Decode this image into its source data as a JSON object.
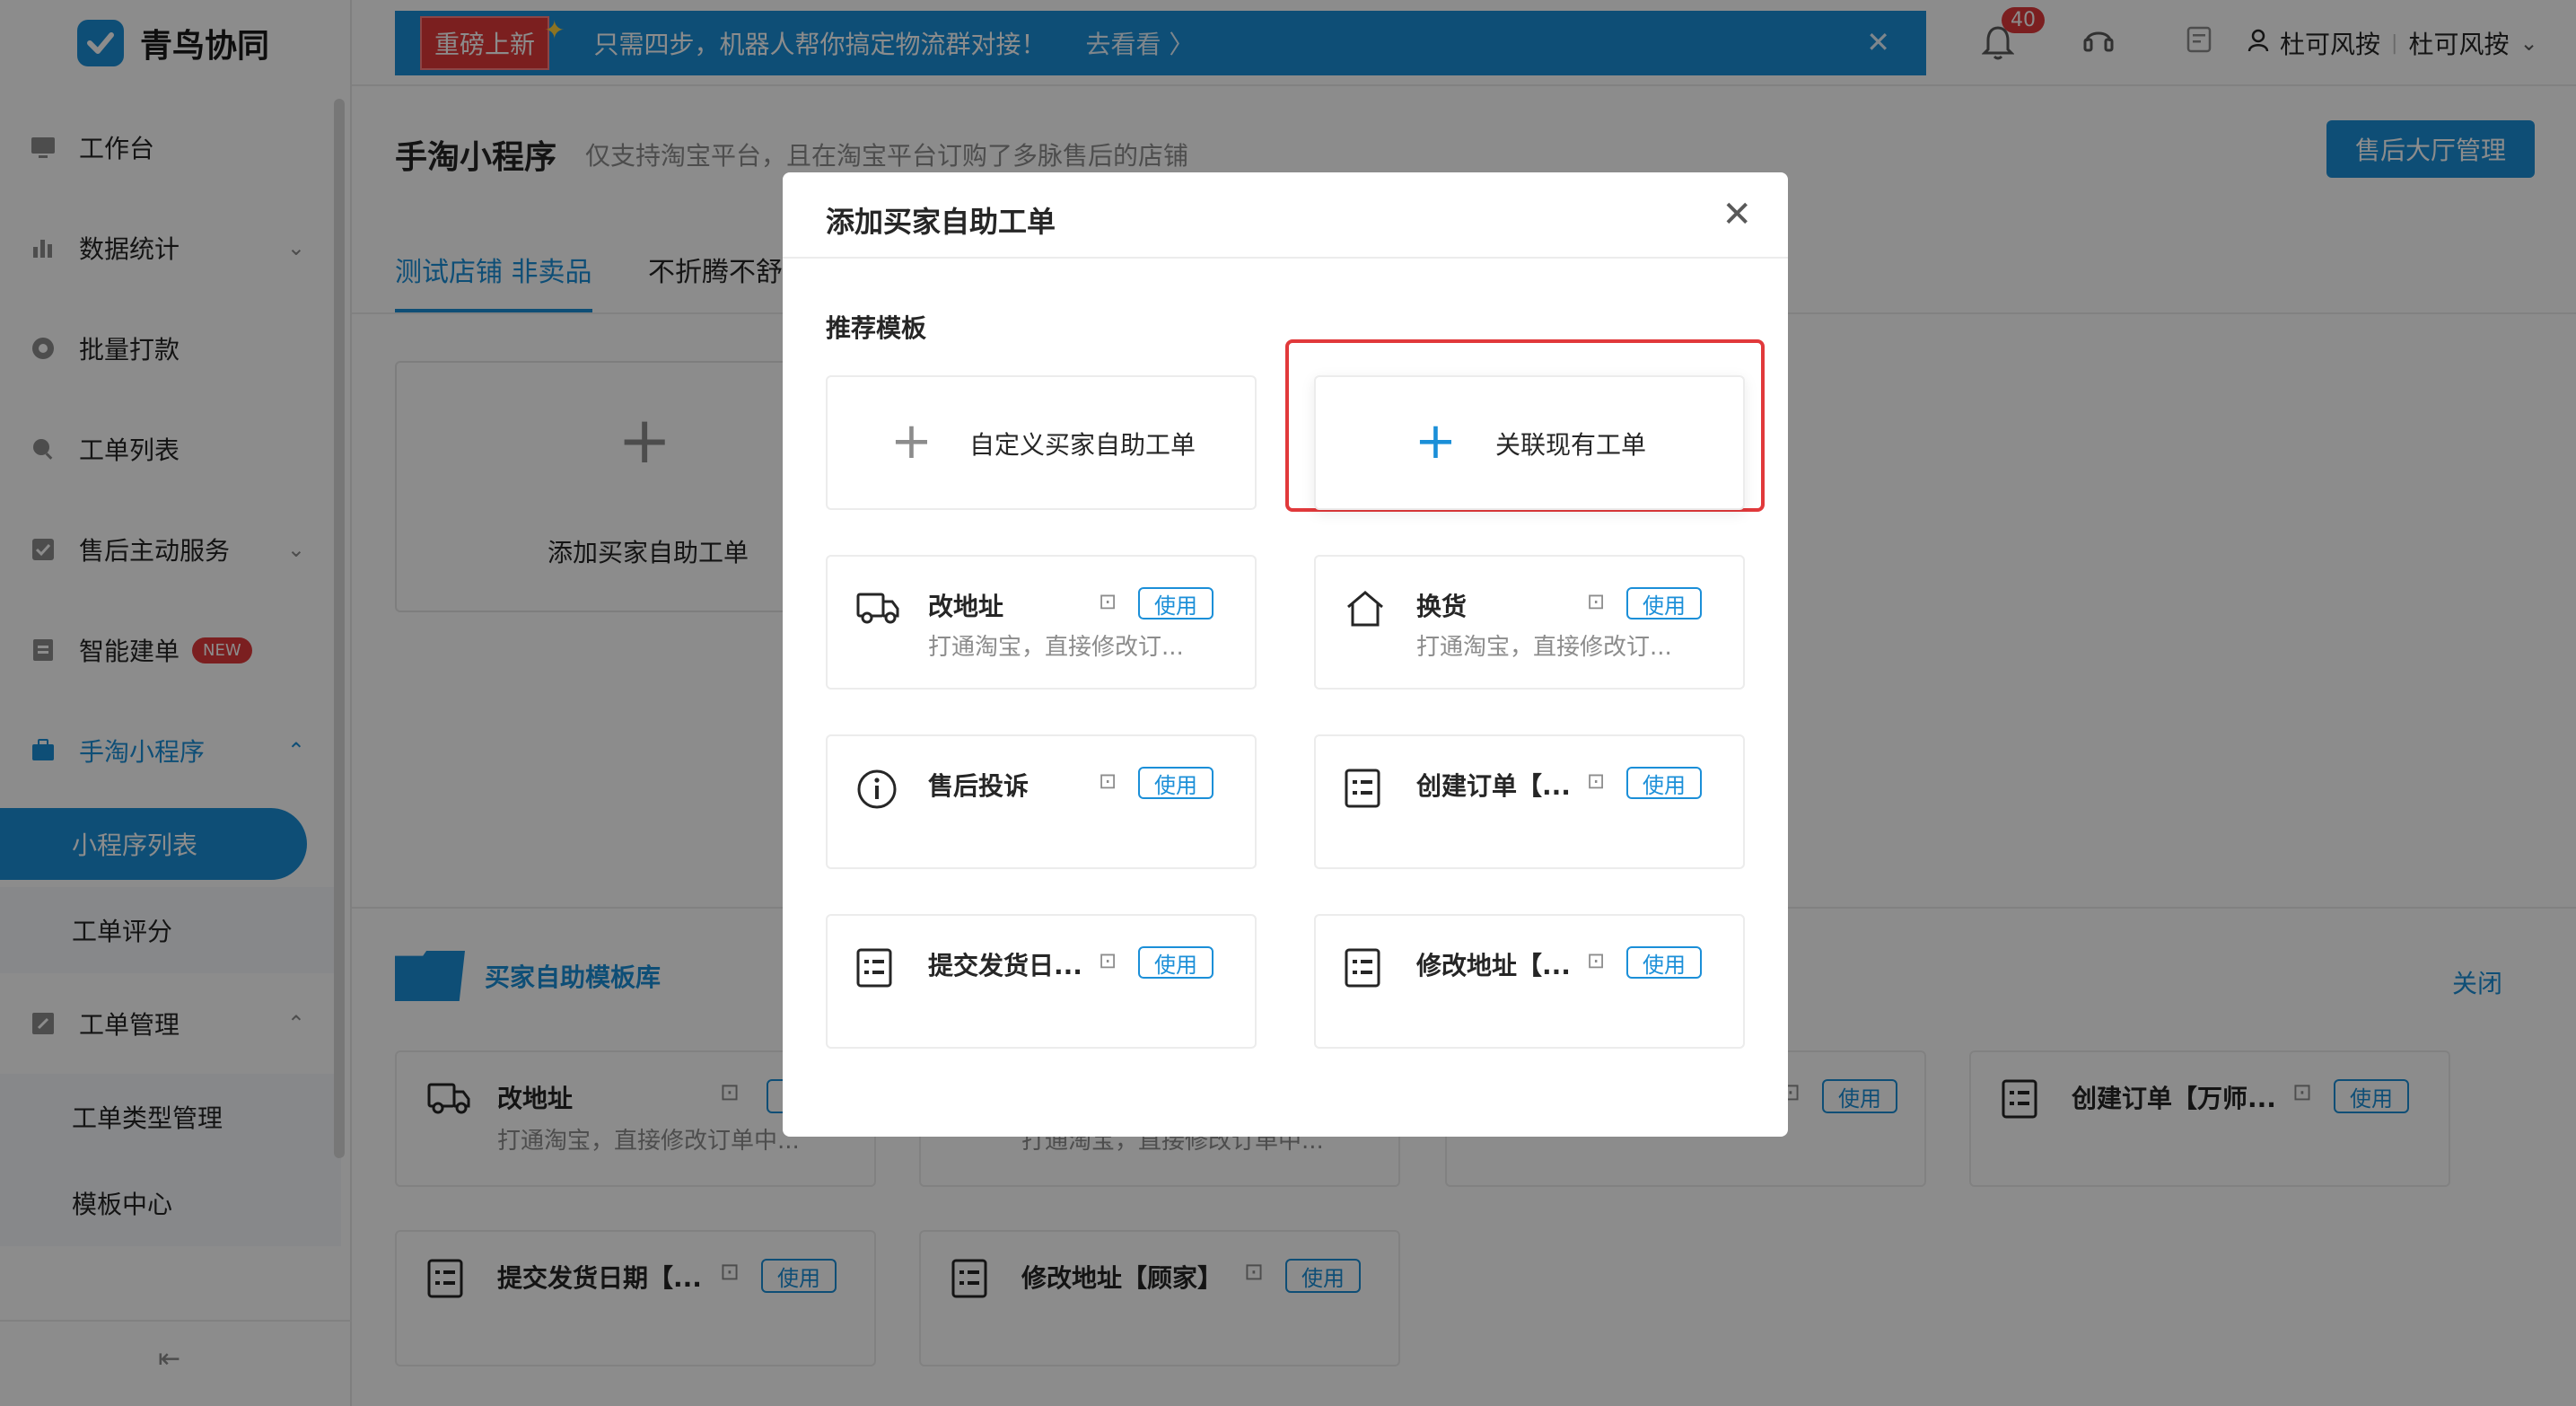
{
  "brand": {
    "name": "青鸟协同",
    "accent": "#1b8fd8"
  },
  "sidebar": {
    "items": [
      {
        "label": "工作台",
        "icon": "monitor-icon"
      },
      {
        "label": "数据统计",
        "icon": "bar-chart-icon"
      },
      {
        "label": "批量打款",
        "icon": "coin-icon"
      },
      {
        "label": "工单列表",
        "icon": "search-icon"
      },
      {
        "label": "售后主动服务",
        "icon": "check-square-icon"
      },
      {
        "label": "智能建单",
        "icon": "document-icon",
        "badge": "NEW"
      },
      {
        "label": "手淘小程序",
        "icon": "briefcase-icon"
      },
      {
        "label": "小程序列表"
      },
      {
        "label": "工单评分"
      },
      {
        "label": "工单管理",
        "icon": "edit-icon"
      },
      {
        "label": "工单类型管理"
      },
      {
        "label": "模板中心"
      }
    ]
  },
  "header": {
    "banner_tag": "重磅上新",
    "banner_msg": "只需四步，机器人帮你搞定物流群对接！",
    "banner_more": "去看看 〉",
    "notif_count": "40",
    "user_name": "杜可风按",
    "shop_name": "杜可风按"
  },
  "page": {
    "title": "手淘小程序",
    "desc": "仅支持淘宝平台，且在淘宝平台订购了多脉售后的店铺",
    "primary_button": "售后大厅管理",
    "tabs": [
      "测试店铺 非卖品",
      "不折腾不舒"
    ],
    "add_card_label": "添加买家自助工单"
  },
  "library": {
    "title": "买家自助模板库",
    "close_label": "关闭",
    "use_label": "使用",
    "templates": [
      {
        "name": "改地址",
        "desc": "打通淘宝，直接修改订单中..."
      },
      {
        "name": "",
        "desc": "打通淘宝，直接修改订单中..."
      },
      {
        "name": "",
        "desc": ""
      },
      {
        "name": "创建订单【万师...",
        "desc": ""
      },
      {
        "name": "提交发货日期【...",
        "desc": ""
      },
      {
        "name": "修改地址【顾家】",
        "desc": ""
      }
    ]
  },
  "modal": {
    "title": "添加买家自助工单",
    "section_label": "推荐模板",
    "custom_card_label": "自定义买家自助工单",
    "link_card_label": "关联现有工单",
    "use_label": "使用",
    "templates": [
      {
        "name": "改地址",
        "desc": "打通淘宝，直接修改订...",
        "icon": "truck-icon"
      },
      {
        "name": "换货",
        "desc": "打通淘宝，直接修改订...",
        "icon": "house-icon"
      },
      {
        "name": "售后投诉",
        "desc": "",
        "icon": "info-icon"
      },
      {
        "name": "创建订单【...",
        "desc": "",
        "icon": "list-icon"
      },
      {
        "name": "提交发货日...",
        "desc": "",
        "icon": "list-icon"
      },
      {
        "name": "修改地址【...",
        "desc": "",
        "icon": "list-icon"
      }
    ]
  }
}
